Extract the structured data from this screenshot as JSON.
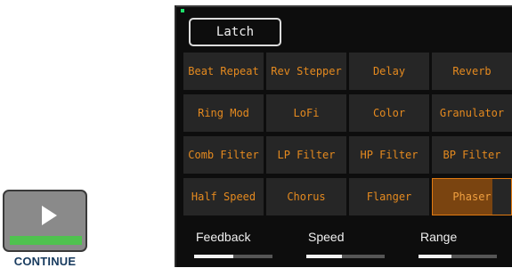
{
  "continue": {
    "label": "CONTINUE",
    "progress": 1.0,
    "bar_color": "#4fc24f"
  },
  "panel": {
    "latch_label": "Latch",
    "accent_color": "#e58a1f",
    "effects": [
      {
        "label": "Beat Repeat",
        "active": false
      },
      {
        "label": "Rev Stepper",
        "active": false
      },
      {
        "label": "Delay",
        "active": false
      },
      {
        "label": "Reverb",
        "active": false
      },
      {
        "label": "Ring Mod",
        "active": false
      },
      {
        "label": "LoFi",
        "active": false
      },
      {
        "label": "Color",
        "active": false
      },
      {
        "label": "Granulator",
        "active": false
      },
      {
        "label": "Comb Filter",
        "active": false
      },
      {
        "label": "LP Filter",
        "active": false
      },
      {
        "label": "HP Filter",
        "active": false
      },
      {
        "label": "BP Filter",
        "active": false
      },
      {
        "label": "Half Speed",
        "active": false
      },
      {
        "label": "Chorus",
        "active": false
      },
      {
        "label": "Flanger",
        "active": false
      },
      {
        "label": "Phaser",
        "active": true,
        "level": 0.76
      }
    ],
    "params": [
      {
        "label": "Feedback",
        "value": 0.5
      },
      {
        "label": "Speed",
        "value": 0.45
      },
      {
        "label": "Range",
        "value": 0.42
      }
    ]
  }
}
